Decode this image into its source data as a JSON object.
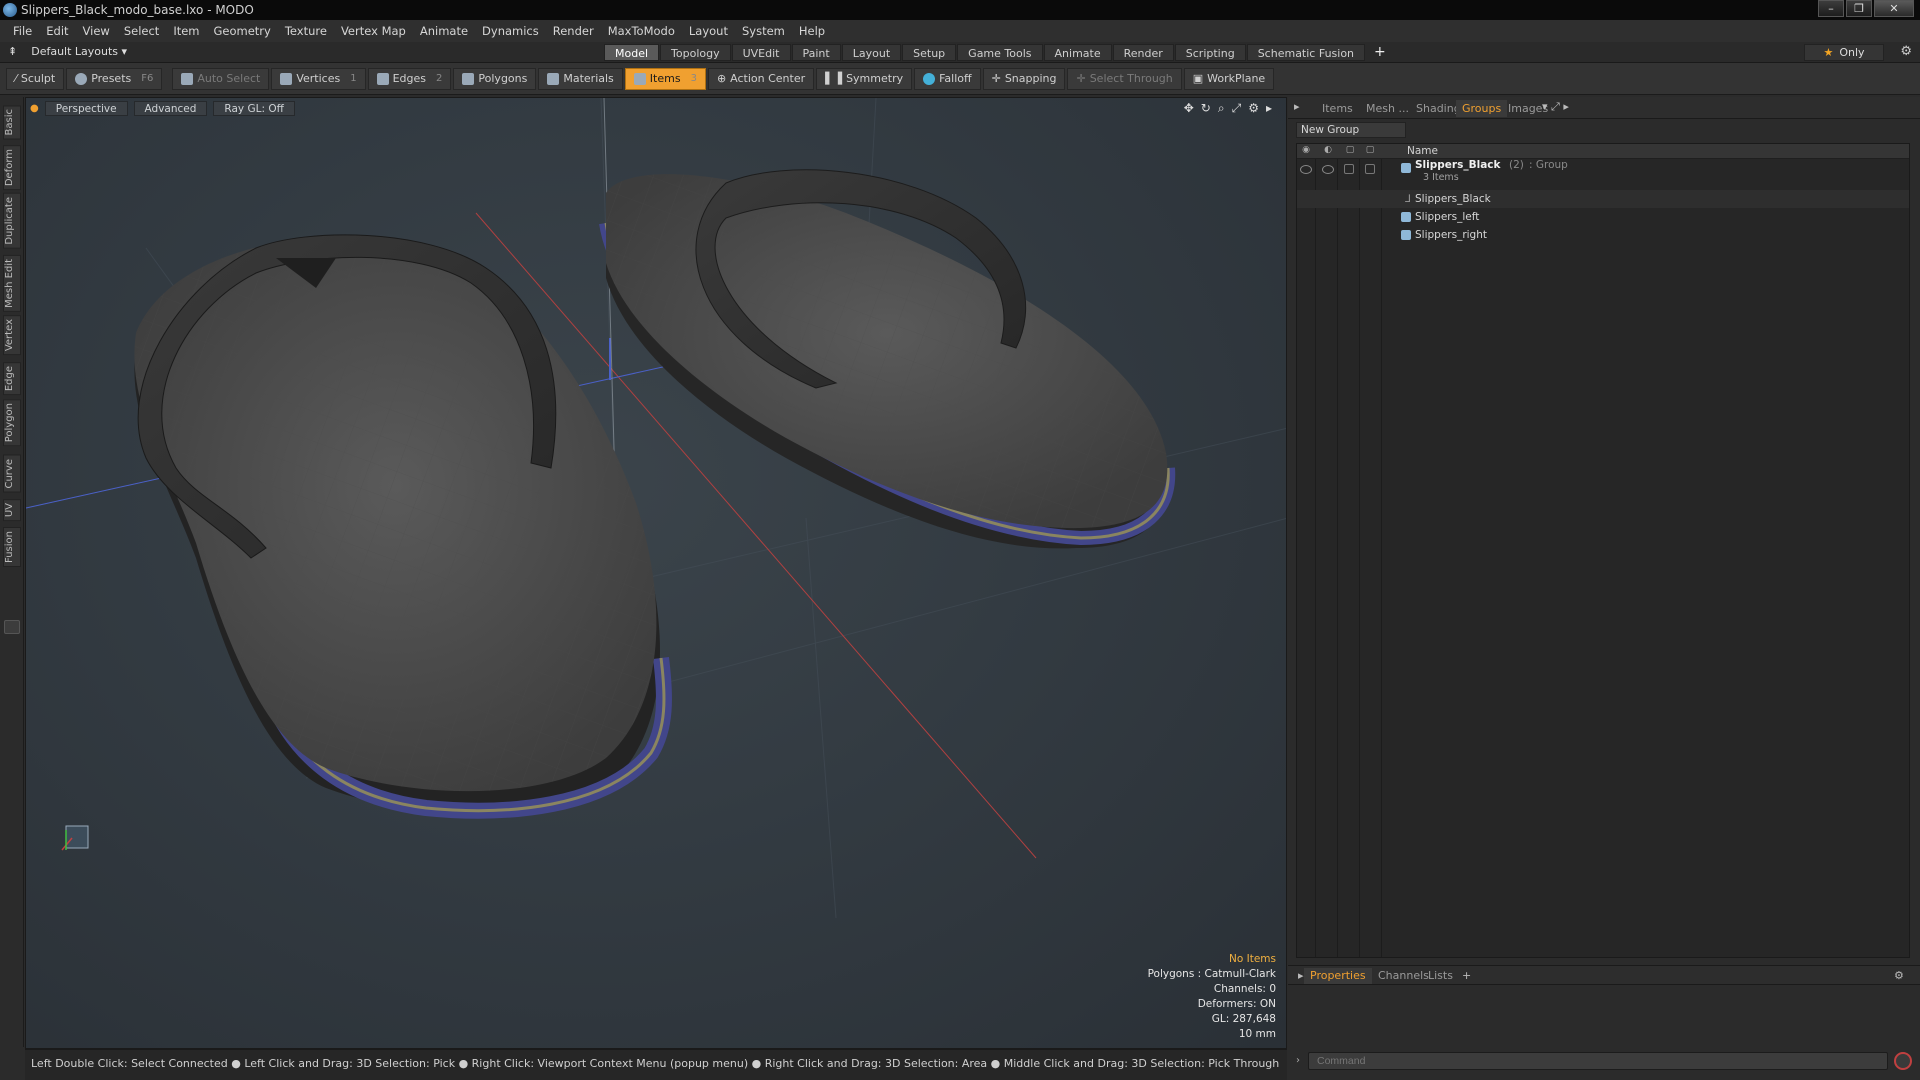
{
  "window": {
    "title": "Slippers_Black_modo_base.lxo - MODO",
    "controls": [
      "–",
      "❐",
      "✕"
    ]
  },
  "menu": [
    "File",
    "Edit",
    "View",
    "Select",
    "Item",
    "Geometry",
    "Texture",
    "Vertex Map",
    "Animate",
    "Dynamics",
    "Render",
    "MaxToModo",
    "Layout",
    "System",
    "Help"
  ],
  "layouts": {
    "label": "Default Layouts ▾"
  },
  "mode_tabs": [
    "Model",
    "Topology",
    "UVEdit",
    "Paint",
    "Layout",
    "Setup",
    "Game Tools",
    "Animate",
    "Render",
    "Scripting",
    "Schematic Fusion"
  ],
  "mode_tab_active": "Model",
  "only_label": "Only",
  "toolbar": {
    "sculpt": "Sculpt",
    "presets": "Presets",
    "presets_key": "F6",
    "auto_select": "Auto Select",
    "vertices": "Vertices",
    "vertices_count": "1",
    "edges": "Edges",
    "edges_count": "2",
    "polygons": "Polygons",
    "materials": "Materials",
    "items": "Items",
    "items_count": "3",
    "action_center": "Action Center",
    "symmetry": "Symmetry",
    "falloff": "Falloff",
    "snapping": "Snapping",
    "select_through": "Select Through",
    "workplane": "WorkPlane"
  },
  "left_tabs": [
    "Basic",
    "Deform",
    "Duplicate",
    "Mesh Edit",
    "Vertex",
    "Edge",
    "Polygon",
    "Curve",
    "UV",
    "Fusion"
  ],
  "viewport": {
    "view_mode": "Perspective",
    "shading": "Advanced",
    "raygl": "Ray GL: Off",
    "stats": {
      "selection": "No Items",
      "polygons": "Polygons : Catmull-Clark",
      "channels": "Channels: 0",
      "deformers": "Deformers: ON",
      "gl": "GL: 287,648",
      "unit": "10 mm"
    }
  },
  "status_bar": "Left Double Click: Select Connected ● Left Click and Drag: 3D Selection: Pick ● Right Click: Viewport Context Menu (popup menu) ● Right Click and Drag: 3D Selection: Area ● Middle Click and Drag: 3D Selection: Pick Through",
  "right_panel": {
    "tabs": [
      "Items",
      "Mesh ...",
      "Shading",
      "Groups",
      "Images"
    ],
    "active_tab": "Groups",
    "new_group": "New Group",
    "column_name": "Name",
    "group": {
      "name": "Slippers_Black",
      "count": "(2)",
      "type": ": Group",
      "sub": "3 Items"
    },
    "children": [
      "Slippers_Black",
      "Slippers_left",
      "Slippers_right"
    ],
    "bottom_tabs": [
      "Properties",
      "Channels",
      "Lists"
    ],
    "bottom_active": "Properties",
    "command_placeholder": "Command"
  }
}
